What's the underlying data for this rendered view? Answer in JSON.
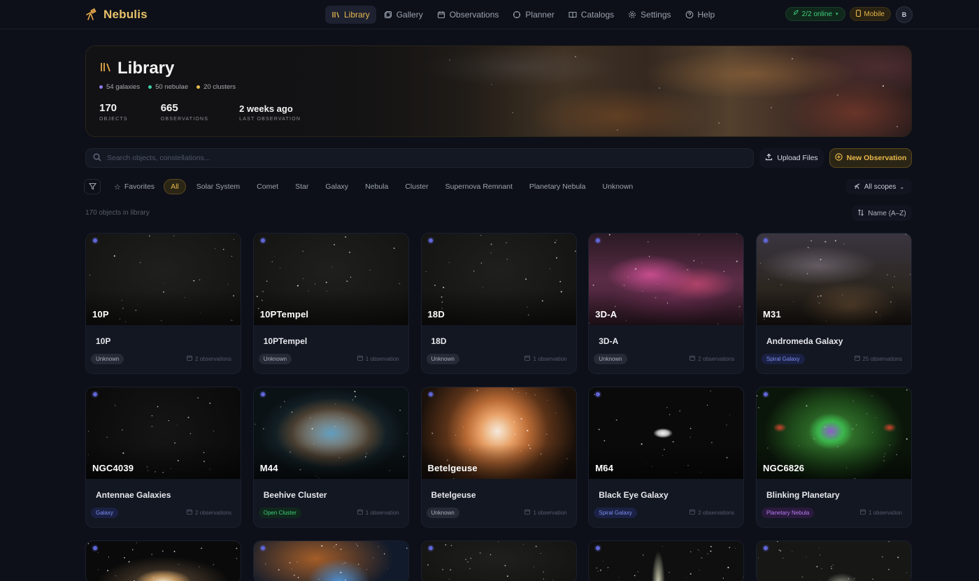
{
  "app": {
    "name": "Nebulis"
  },
  "nav": {
    "items": [
      {
        "label": "Library",
        "icon": "library-icon",
        "active": true
      },
      {
        "label": "Gallery",
        "icon": "gallery-icon",
        "active": false
      },
      {
        "label": "Observations",
        "icon": "calendar-icon",
        "active": false
      },
      {
        "label": "Planner",
        "icon": "compass-icon",
        "active": false
      },
      {
        "label": "Catalogs",
        "icon": "book-icon",
        "active": false
      },
      {
        "label": "Settings",
        "icon": "gear-icon",
        "active": false
      },
      {
        "label": "Help",
        "icon": "help-icon",
        "active": false
      }
    ],
    "online": "2/2 online",
    "mobile": "Mobile",
    "avatar": "B"
  },
  "hero": {
    "title": "Library",
    "galaxies": "54",
    "galaxies_label": "galaxies",
    "nebulae": "50",
    "nebulae_label": "nebulae",
    "clusters": "20",
    "clusters_label": "clusters",
    "stats": [
      {
        "value": "170",
        "label": "OBJECTS"
      },
      {
        "value": "665",
        "label": "OBSERVATIONS"
      },
      {
        "value": "2 weeks ago",
        "label": "LAST OBSERVATION"
      }
    ]
  },
  "toolbar": {
    "search_placeholder": "Search objects, constellations...",
    "upload_label": "Upload Files",
    "new_label": "New Observation"
  },
  "filters": {
    "favorites": "Favorites",
    "chips": [
      "All",
      "Solar System",
      "Comet",
      "Star",
      "Galaxy",
      "Nebula",
      "Cluster",
      "Supernova Remnant",
      "Planetary Nebula",
      "Unknown"
    ],
    "active": "All",
    "scope": "All scopes"
  },
  "list": {
    "count_label": "170 objects in library",
    "sort_label": "Name (A–Z)"
  },
  "cards": [
    {
      "catalog": "10P",
      "name": "10P",
      "type": "Unknown",
      "type_class": "unknown",
      "obs": "2 observations",
      "img": "stars"
    },
    {
      "catalog": "10PTempel",
      "name": "10PTempel",
      "type": "Unknown",
      "type_class": "unknown",
      "obs": "1 observation",
      "img": "stars"
    },
    {
      "catalog": "18D",
      "name": "18D",
      "type": "Unknown",
      "type_class": "unknown",
      "obs": "1 observation",
      "img": "stars"
    },
    {
      "catalog": "3D-A",
      "name": "3D-A",
      "type": "Unknown",
      "type_class": "unknown",
      "obs": "2 observations",
      "img": "pink"
    },
    {
      "catalog": "M31",
      "name": "Andromeda Galaxy",
      "type": "Spiral Galaxy",
      "type_class": "galaxy",
      "obs": "25 observations",
      "img": "dust"
    },
    {
      "catalog": "NGC4039",
      "name": "Antennae Galaxies",
      "type": "Galaxy",
      "type_class": "galaxy",
      "obs": "2 observations",
      "img": "antennae"
    },
    {
      "catalog": "M44",
      "name": "Beehive Cluster",
      "type": "Open Cluster",
      "type_class": "cluster",
      "obs": "1 observation",
      "img": "crab"
    },
    {
      "catalog": "Betelgeuse",
      "name": "Betelgeuse",
      "type": "Unknown",
      "type_class": "unknown",
      "obs": "1 observation",
      "img": "betelgeuse"
    },
    {
      "catalog": "M64",
      "name": "Black Eye Galaxy",
      "type": "Spiral Galaxy",
      "type_class": "galaxy",
      "obs": "2 observations",
      "img": "blackeye"
    },
    {
      "catalog": "NGC6826",
      "name": "Blinking Planetary",
      "type": "Planetary Nebula",
      "type_class": "nebula",
      "obs": "1 observation",
      "img": "planetary"
    }
  ],
  "partial_cards": [
    "spiral",
    "bubble",
    "stars",
    "comet",
    "dim"
  ]
}
